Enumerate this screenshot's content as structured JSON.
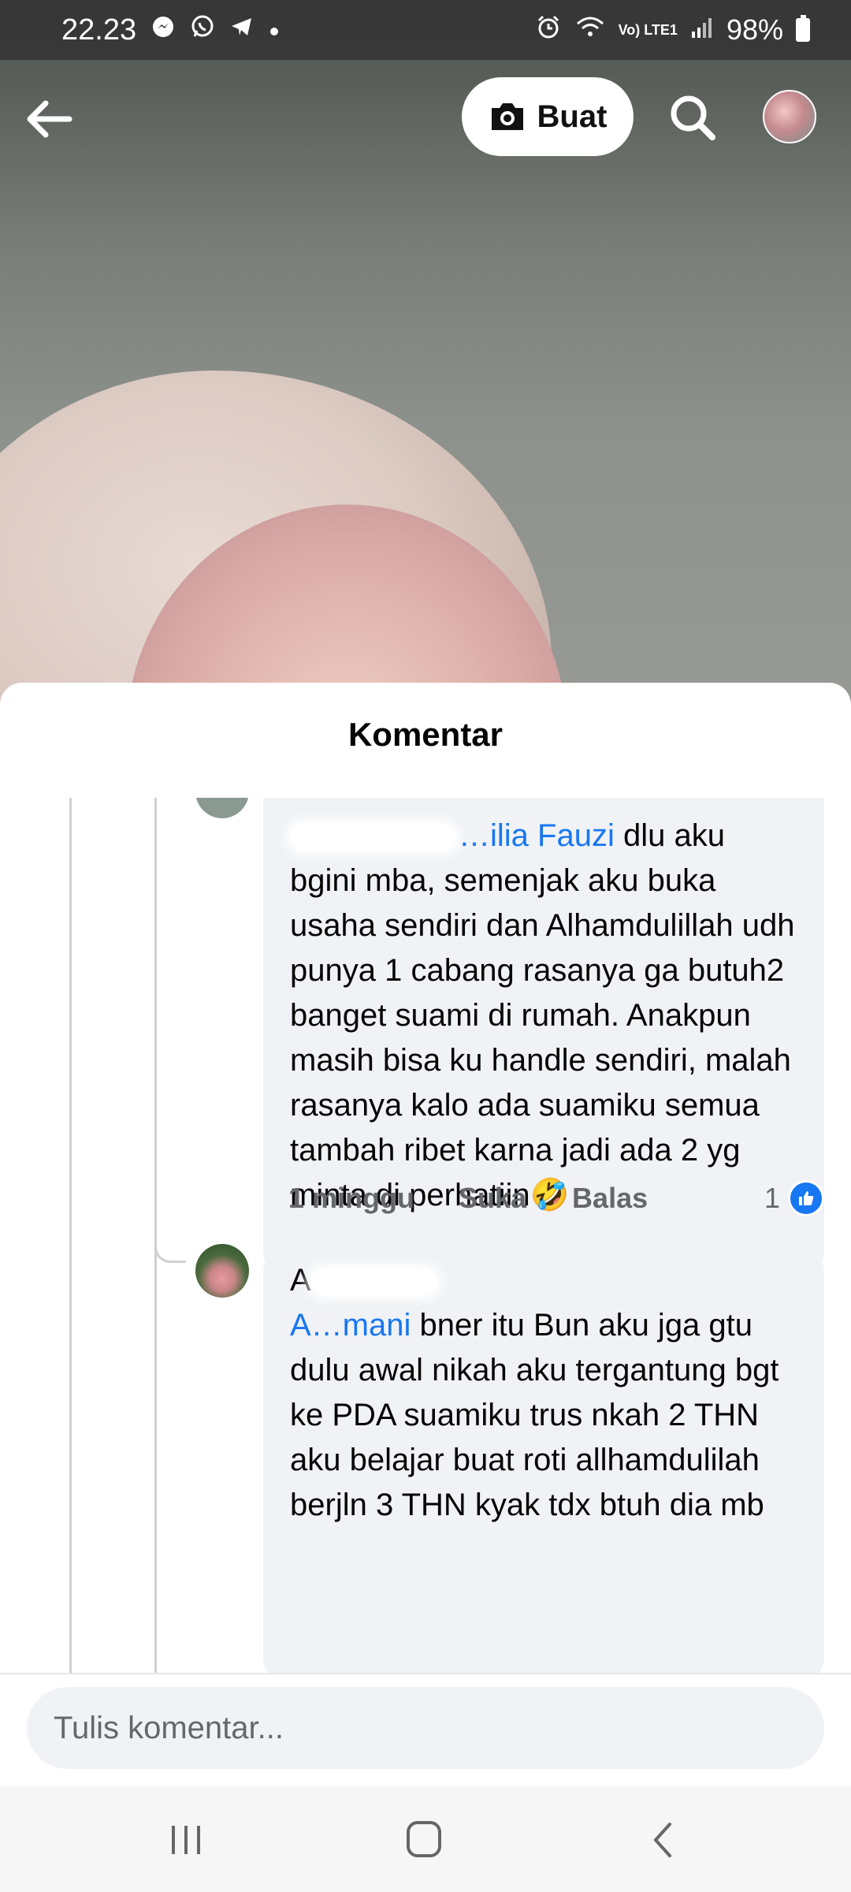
{
  "status_bar": {
    "time": "22.23",
    "battery": "98%",
    "lte_label": "Vo) LTE1"
  },
  "top_bar": {
    "create_label": "Buat"
  },
  "sheet": {
    "title": "Komentar"
  },
  "comments": [
    {
      "author_visible": "",
      "mention_visible": "…ilia Fauzi",
      "text": " dlu aku bgini mba, semenjak aku buka usaha sendiri dan Alhamdulillah udh punya 1 cabang rasanya ga butuh2 banget suami di rumah. Anakpun masih bisa ku handle sendiri, malah rasanya kalo ada suamiku semua tambah ribet karna jadi ada 2 yg minta di perhatiin🤣",
      "time": "1 minggu",
      "like_label": "Suka",
      "reply_label": "Balas",
      "reaction_count": "1"
    },
    {
      "author_visible": "A",
      "mention_visible": "A…mani",
      "text": " bner itu Bun aku jga gtu dulu awal nikah aku tergantung bgt ke PDA suamiku trus nkah 2 THN aku belajar buat roti allhamdulilah berjln 3 THN kyak tdx btuh dia mb"
    }
  ],
  "footer": {
    "input_placeholder": "Tulis komentar..."
  },
  "colors": {
    "accent": "#1877f2",
    "bubble": "#f0f2f5",
    "meta_text": "#65676b"
  }
}
